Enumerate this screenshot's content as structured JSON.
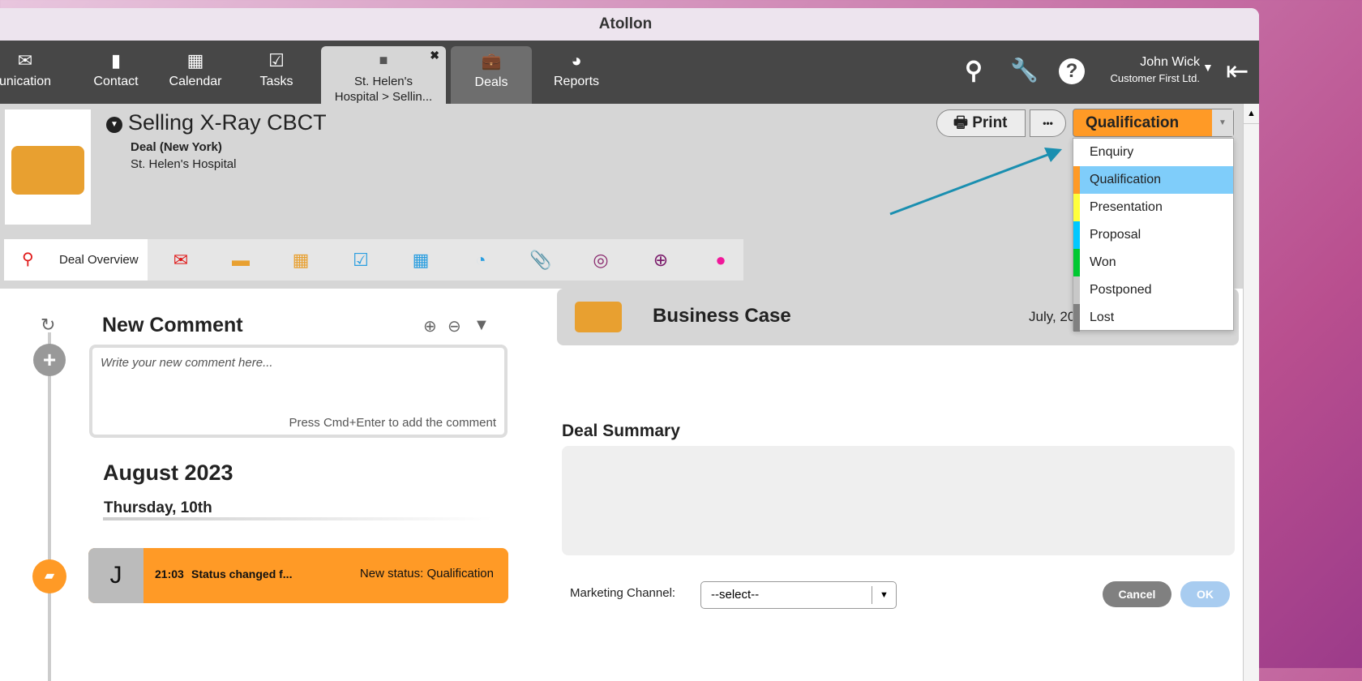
{
  "window": {
    "title": "Atollon"
  },
  "nav": {
    "items": [
      {
        "label": "unication",
        "icon": "envelope-icon"
      },
      {
        "label": "Contact",
        "icon": "contact-book-icon"
      },
      {
        "label": "Calendar",
        "icon": "calendar-icon"
      },
      {
        "label": "Tasks",
        "icon": "checkbox-icon"
      }
    ],
    "open_tab": {
      "label_line1": "St. Helen's",
      "label_line2": "Hospital > Sellin...",
      "close": "✖"
    },
    "deals": "Deals",
    "reports": "Reports",
    "user": {
      "name": "John Wick",
      "company": "Customer First Ltd."
    }
  },
  "deal": {
    "title": "Selling X-Ray CBCT",
    "type": "Deal (New York)",
    "company": "St. Helen's Hospital"
  },
  "toolbar": {
    "print": "Print",
    "more": "•••",
    "status": "Qualification"
  },
  "status_options": [
    {
      "label": "Enquiry",
      "color": "#ffffff"
    },
    {
      "label": "Qualification",
      "color": "#ff9a26"
    },
    {
      "label": "Presentation",
      "color": "#ffff3c"
    },
    {
      "label": "Proposal",
      "color": "#00c8ff"
    },
    {
      "label": "Won",
      "color": "#00c832"
    },
    {
      "label": "Postponed",
      "color": "#c8c8c8"
    },
    {
      "label": "Lost",
      "color": "#808080"
    }
  ],
  "tabs": {
    "overview": "Deal Overview"
  },
  "comments": {
    "title": "New Comment",
    "placeholder": "Write your new comment here...",
    "hint": "Press Cmd+Enter to add the comment",
    "month": "August 2023",
    "day": "Thursday, 10th",
    "entry": {
      "avatar": "J",
      "time": "21:03",
      "text": "Status changed f...",
      "status": "New status: Qualification"
    }
  },
  "business_case": {
    "title": "Business Case",
    "date": "July, 20"
  },
  "summary": {
    "title": "Deal Summary"
  },
  "marketing": {
    "label": "Marketing Channel:",
    "value": "--select--"
  },
  "actions": {
    "cancel": "Cancel",
    "ok": "OK"
  }
}
